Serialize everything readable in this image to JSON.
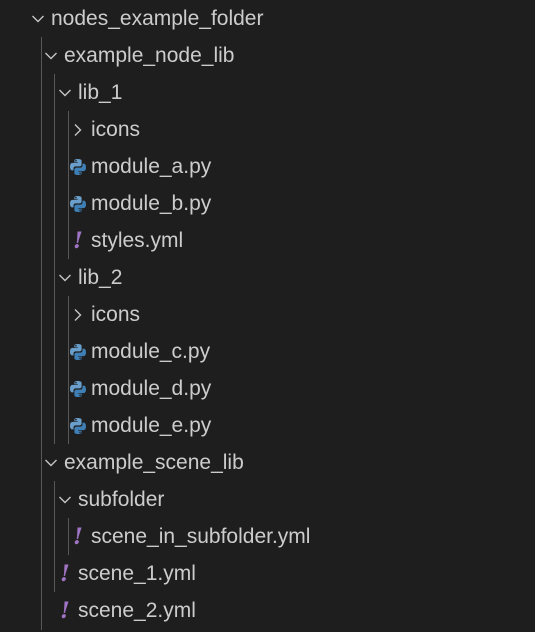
{
  "explorer": {
    "root": {
      "label": "nodes_example_folder",
      "expanded": true
    },
    "example_node_lib": {
      "label": "example_node_lib",
      "expanded": true
    },
    "lib_1": {
      "label": "lib_1",
      "expanded": true
    },
    "lib_1_icons": {
      "label": "icons",
      "expanded": false
    },
    "module_a": {
      "label": "module_a.py",
      "icon": "python-icon"
    },
    "module_b": {
      "label": "module_b.py",
      "icon": "python-icon"
    },
    "styles": {
      "label": "styles.yml",
      "icon": "yaml-icon",
      "glyph": "!"
    },
    "lib_2": {
      "label": "lib_2",
      "expanded": true
    },
    "lib_2_icons": {
      "label": "icons",
      "expanded": false
    },
    "module_c": {
      "label": "module_c.py",
      "icon": "python-icon"
    },
    "module_d": {
      "label": "module_d.py",
      "icon": "python-icon"
    },
    "module_e": {
      "label": "module_e.py",
      "icon": "python-icon"
    },
    "example_scene_lib": {
      "label": "example_scene_lib",
      "expanded": true
    },
    "subfolder": {
      "label": "subfolder",
      "expanded": true
    },
    "scene_in_subfolder": {
      "label": "scene_in_subfolder.yml",
      "icon": "yaml-icon",
      "glyph": "!"
    },
    "scene_1": {
      "label": "scene_1.yml",
      "icon": "yaml-icon",
      "glyph": "!"
    },
    "scene_2": {
      "label": "scene_2.yml",
      "icon": "yaml-icon",
      "glyph": "!"
    }
  },
  "colors": {
    "background": "#1e1e1e",
    "text": "#cccccc",
    "chevron": "#c5c5c5",
    "indent_guide": "#585858",
    "python_blue": "#3e7fb6",
    "python_light": "#6a9fcb",
    "yaml_purple": "#a074c4"
  }
}
